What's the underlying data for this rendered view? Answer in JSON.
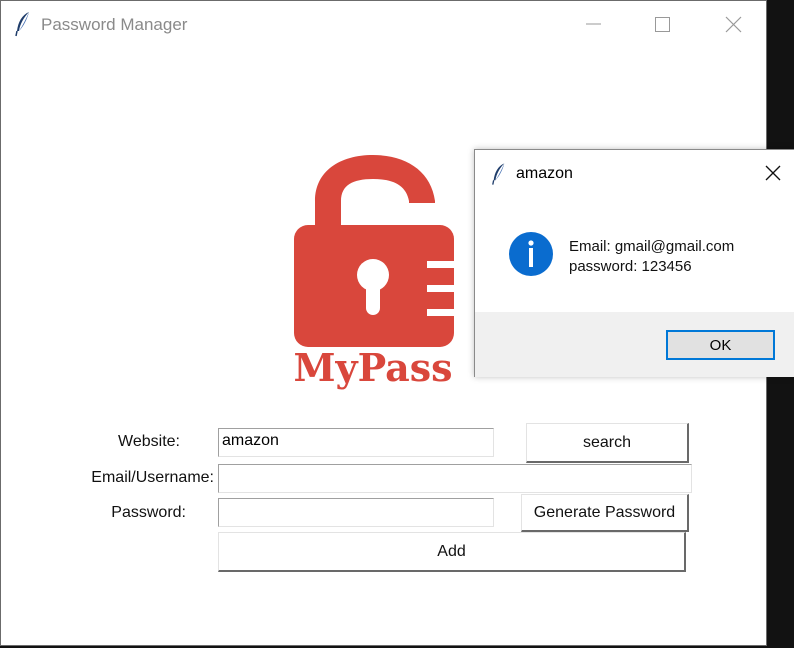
{
  "window": {
    "title": "Password Manager",
    "icon": "feather-icon"
  },
  "logo": {
    "text": "MyPass",
    "color": "#d9473c"
  },
  "form": {
    "website_label": "Website:",
    "website_value": "amazon",
    "email_label": "Email/Username:",
    "email_value": "",
    "password_label": "Password:",
    "password_value": "",
    "search_label": "search",
    "generate_label": "Generate Password",
    "add_label": "Add"
  },
  "dialog": {
    "title": "amazon",
    "icon": "info-icon",
    "message_line1": "Email: gmail@gmail.com",
    "message_line2": "password: 123456",
    "ok_label": "OK",
    "accent": "#0078d7"
  }
}
